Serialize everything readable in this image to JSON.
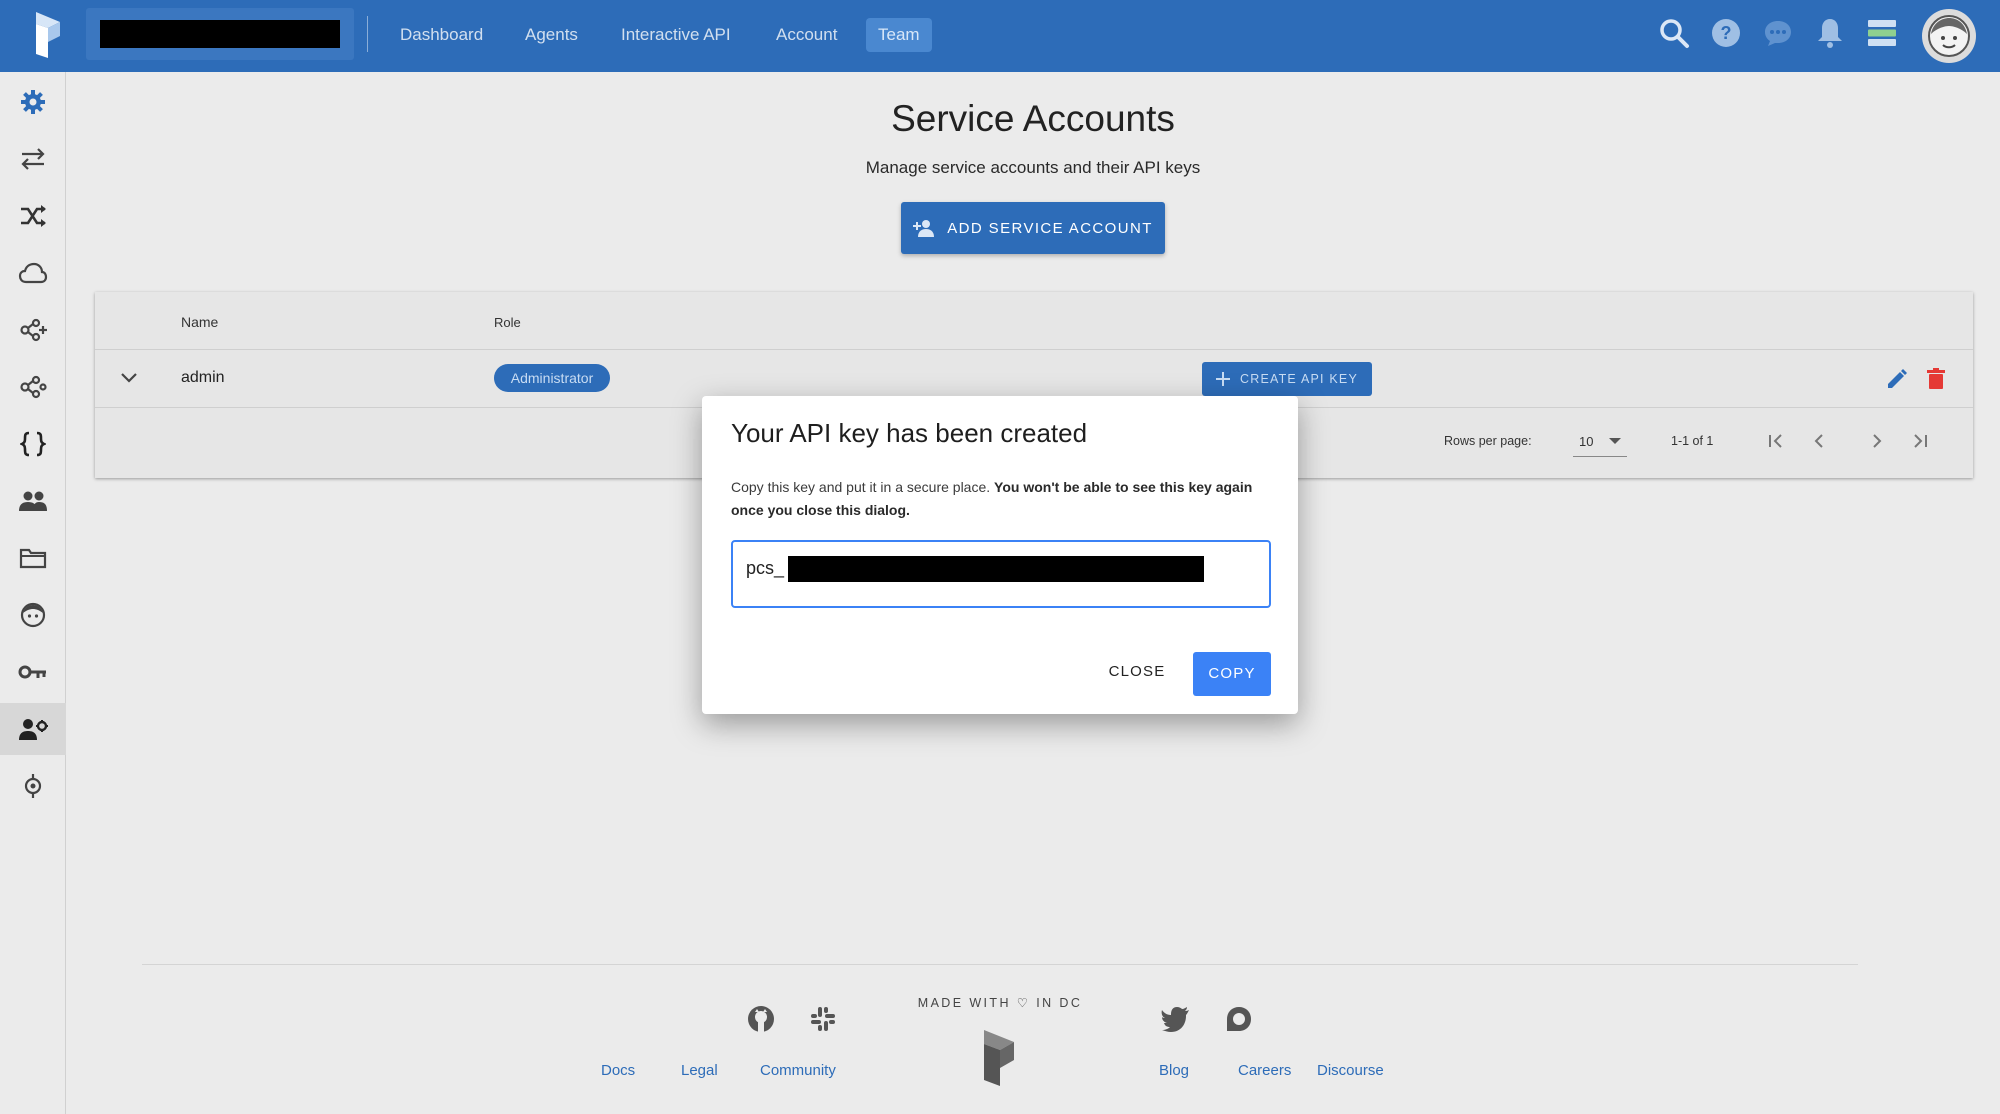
{
  "colors": {
    "topbar": "#2d6cb8",
    "accent": "#3b82f6",
    "danger": "#e53935",
    "background": "#ebebeb"
  },
  "topbar": {
    "org_name_redacted": true,
    "nav": [
      {
        "label": "Dashboard",
        "active": false
      },
      {
        "label": "Agents",
        "active": false
      },
      {
        "label": "Interactive API",
        "active": false
      },
      {
        "label": "Account",
        "active": false
      },
      {
        "label": "Team",
        "active": true
      }
    ],
    "icons": [
      "search-icon",
      "help-icon",
      "chat-icon",
      "notifications-icon",
      "server-status-icon",
      "user-avatar"
    ]
  },
  "sidebar": {
    "items": [
      {
        "icon": "gear-icon",
        "active": false
      },
      {
        "icon": "arrows-exchange-icon",
        "active": false
      },
      {
        "icon": "shuffle-icon",
        "active": false
      },
      {
        "icon": "cloud-icon",
        "active": false
      },
      {
        "icon": "automation-add-icon",
        "active": false
      },
      {
        "icon": "automation-icon",
        "active": false
      },
      {
        "icon": "braces-icon",
        "active": false
      },
      {
        "icon": "people-icon",
        "active": false
      },
      {
        "icon": "folder-icon",
        "active": false
      },
      {
        "icon": "face-icon",
        "active": false
      },
      {
        "icon": "key-icon",
        "active": false
      },
      {
        "icon": "manage-accounts-icon",
        "active": true
      },
      {
        "icon": "target-icon",
        "active": false
      }
    ]
  },
  "page": {
    "title": "Service Accounts",
    "subtitle": "Manage service accounts and their API keys",
    "add_button": "ADD SERVICE ACCOUNT"
  },
  "table": {
    "headers": {
      "name": "Name",
      "role": "Role"
    },
    "rows": [
      {
        "name": "admin",
        "role": "Administrator",
        "create_key": "CREATE API KEY"
      }
    ],
    "footer": {
      "rows_per_page_label": "Rows per page:",
      "rows_per_page_value": "10",
      "range": "1-1 of 1"
    }
  },
  "dialog": {
    "title": "Your API key has been created",
    "message_plain": "Copy this key and put it in a secure place. ",
    "message_bold": "You won't be able to see this key again once you close this dialog.",
    "key_prefix": "pcs_",
    "close_label": "CLOSE",
    "copy_label": "COPY"
  },
  "footer": {
    "made_with": "MADE WITH ♡ IN DC",
    "links": {
      "docs": "Docs",
      "legal": "Legal",
      "community": "Community",
      "blog": "Blog",
      "careers": "Careers",
      "discourse": "Discourse"
    },
    "icons": [
      "github-icon",
      "slack-icon",
      "twitter-icon",
      "discourse-icon"
    ]
  }
}
